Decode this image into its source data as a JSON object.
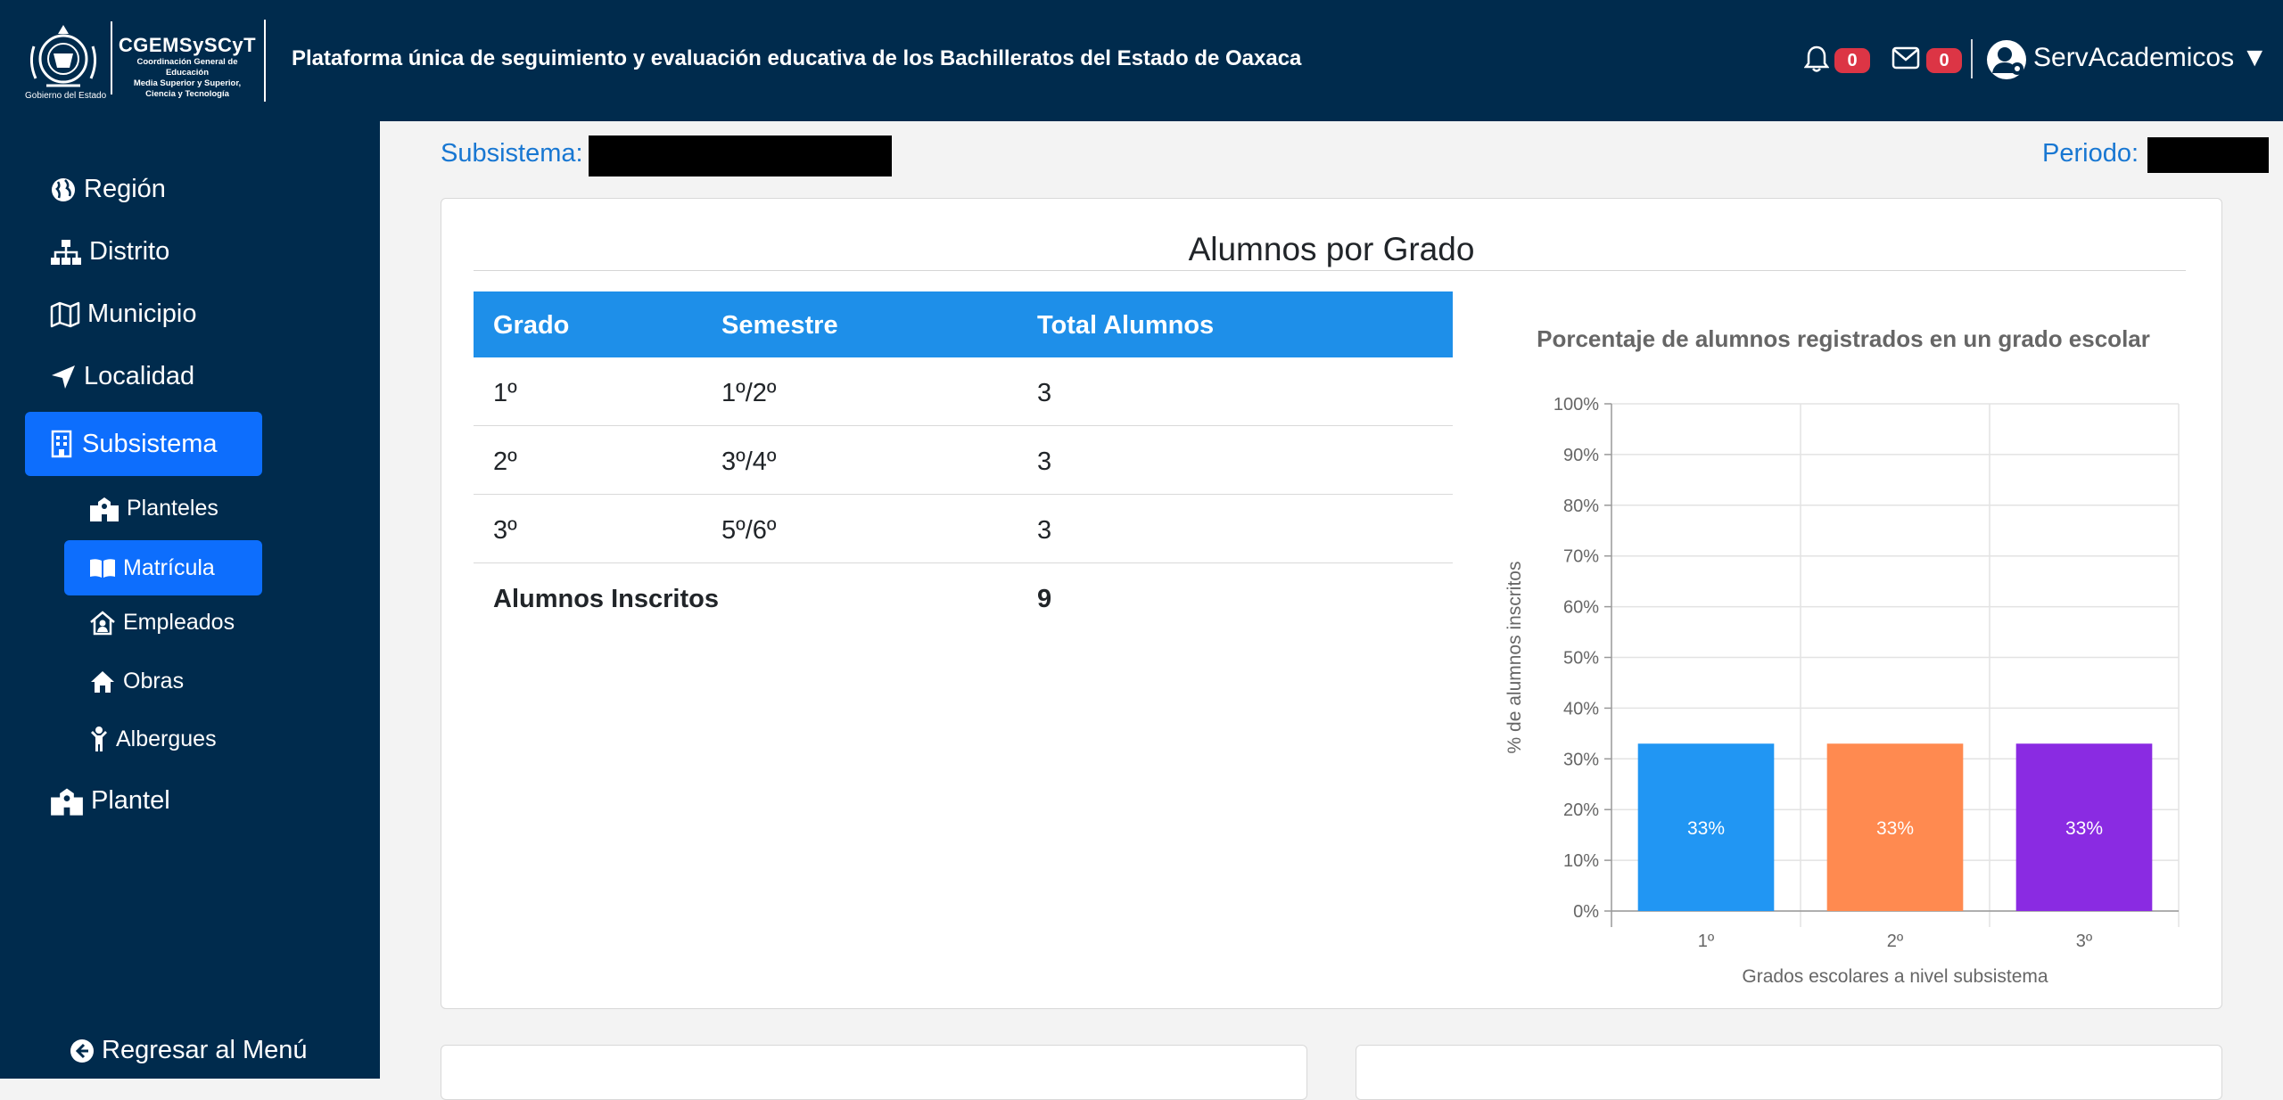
{
  "header": {
    "logo": {
      "acronym": "CGEMSySCyT",
      "subtitle_lines": [
        "Coordinación General de Educación",
        "Media Superior y Superior,",
        "Ciencia y Tecnología"
      ],
      "gobierno": "Gobierno del Estado"
    },
    "title": "Plataforma única de seguimiento y evaluación educativa de los Bachilleratos del Estado de Oaxaca",
    "notifications_count": "0",
    "messages_count": "0",
    "user_name": "ServAcademicos ▼"
  },
  "sidebar": {
    "items": [
      {
        "label": "Región",
        "icon": "globe-icon"
      },
      {
        "label": "Distrito",
        "icon": "sitemap-icon"
      },
      {
        "label": "Municipio",
        "icon": "map-icon"
      },
      {
        "label": "Localidad",
        "icon": "location-arrow-icon"
      },
      {
        "label": "Subsistema",
        "icon": "building-icon",
        "active": true
      },
      {
        "label": "Planteles",
        "icon": "school-icon"
      },
      {
        "label": "Matrícula",
        "icon": "book-open-icon",
        "active": true
      },
      {
        "label": "Empleados",
        "icon": "house-user-icon"
      },
      {
        "label": "Obras",
        "icon": "home-icon"
      },
      {
        "label": "Albergues",
        "icon": "child-icon"
      },
      {
        "label": "Plantel",
        "icon": "school-icon"
      }
    ],
    "back_label": "Regresar al Menú"
  },
  "main": {
    "subsistema_label": "Subsistema:",
    "periodo_label": "Periodo:",
    "card_title": "Alumnos por Grado",
    "table": {
      "headers": [
        "Grado",
        "Semestre",
        "Total Alumnos"
      ],
      "rows": [
        [
          "1º",
          "1º/2º",
          "3"
        ],
        [
          "2º",
          "3º/4º",
          "3"
        ],
        [
          "3º",
          "5º/6º",
          "3"
        ]
      ],
      "total_label": "Alumnos Inscritos",
      "total_value": "9"
    }
  },
  "chart_data": {
    "type": "bar",
    "title": "Porcentaje de alumnos registrados en un grado escolar",
    "xlabel": "Grados escolares a nivel subsistema",
    "ylabel": "% de alumnos inscritos",
    "categories": [
      "1º",
      "2º",
      "3º"
    ],
    "values": [
      33,
      33,
      33
    ],
    "data_labels": [
      "33%",
      "33%",
      "33%"
    ],
    "colors": [
      "#2196f3",
      "#ff8a50",
      "#8a2be2"
    ],
    "ylim": [
      0,
      100
    ],
    "yticks": [
      "0%",
      "10%",
      "20%",
      "30%",
      "40%",
      "50%",
      "60%",
      "70%",
      "80%",
      "90%",
      "100%"
    ],
    "grid": true
  },
  "colors": {
    "navy": "#002b4d",
    "accent_blue": "#0d6efd",
    "table_header": "#1e8fe9",
    "link_blue": "#1877d2",
    "badge_red": "#dc3545"
  }
}
